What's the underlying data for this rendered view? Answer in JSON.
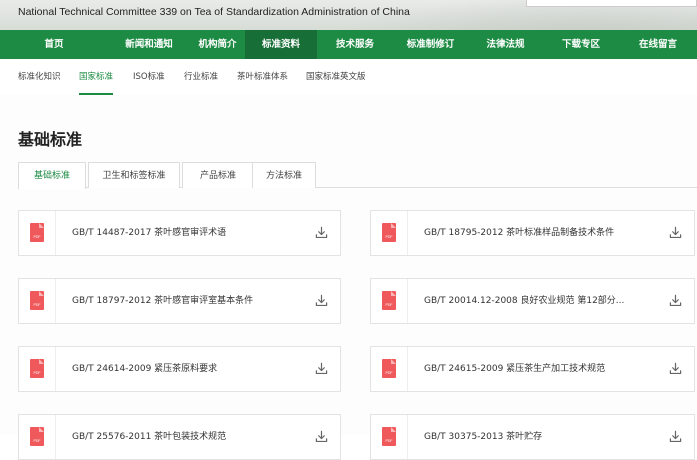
{
  "header": {
    "subtitle": "National Technical Committee 339 on Tea of Standardization Administration of China"
  },
  "nav": {
    "items": [
      {
        "label": "首页",
        "active": false
      },
      {
        "label": "新闻和通知",
        "active": false
      },
      {
        "label": "机构简介",
        "active": false
      },
      {
        "label": "标准资料",
        "active": true
      },
      {
        "label": "技术服务",
        "active": false
      },
      {
        "label": "标准制修订",
        "active": false
      },
      {
        "label": "法律法规",
        "active": false
      },
      {
        "label": "下载专区",
        "active": false
      },
      {
        "label": "在线留言",
        "active": false
      }
    ]
  },
  "subnav": {
    "items": [
      {
        "label": "标准化知识",
        "active": false
      },
      {
        "label": "国家标准",
        "active": true
      },
      {
        "label": "ISO标准",
        "active": false
      },
      {
        "label": "行业标准",
        "active": false
      },
      {
        "label": "茶叶标准体系",
        "active": false
      },
      {
        "label": "国家标准英文版",
        "active": false
      }
    ]
  },
  "page": {
    "title": "基础标准"
  },
  "tabs": [
    {
      "label": "基础标准",
      "active": true
    },
    {
      "label": "卫生和标签标准",
      "active": false
    },
    {
      "label": "产品标准",
      "active": false
    },
    {
      "label": "方法标准",
      "active": false
    }
  ],
  "pdf_badge": "PDF",
  "documents": [
    {
      "title": "GB/T 14487-2017 茶叶感官审评术语"
    },
    {
      "title": "GB/T 18795-2012 茶叶标准样品制备技术条件"
    },
    {
      "title": "GB/T 18797-2012 茶叶感官审评室基本条件"
    },
    {
      "title": "GB/T 20014.12-2008 良好农业规范 第12部分..."
    },
    {
      "title": "GB/T 24614-2009 紧压茶原料要求"
    },
    {
      "title": "GB/T 24615-2009 紧压茶生产加工技术规范"
    },
    {
      "title": "GB/T 25576-2011 茶叶包装技术规范"
    },
    {
      "title": "GB/T 30375-2013 茶叶贮存"
    }
  ],
  "colors": {
    "brand_green": "#1d8b44",
    "pdf_red": "#f0595b"
  },
  "icons": {
    "file": "pdf-icon",
    "download": "download-icon"
  }
}
